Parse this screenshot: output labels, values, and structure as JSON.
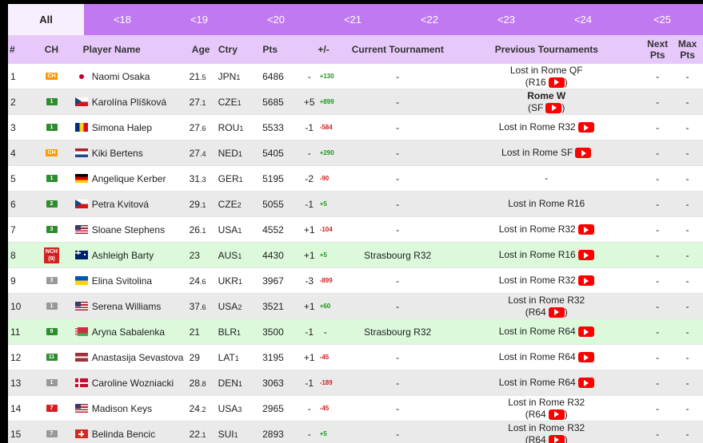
{
  "tabs": [
    "All",
    "<18",
    "<19",
    "<20",
    "<21",
    "<22",
    "<23",
    "<24",
    "<25"
  ],
  "headers": {
    "rank": "#",
    "ch": "CH",
    "name": "Player Name",
    "age": "Age",
    "ctry": "Ctry",
    "pts": "Pts",
    "pm": "+/-",
    "current": "Current Tournament",
    "previous": "Previous Tournaments",
    "next_a": "Next",
    "next_b": "Pts",
    "max_a": "Max",
    "max_b": "Pts"
  },
  "colors": {
    "tab_bg": "#c079f0",
    "header_bg": "#e6c9fa",
    "gain": "#1a9a1a",
    "loss": "#d42020",
    "youtube": "#ff0000"
  },
  "rows": [
    {
      "rank": "1",
      "ch": "CH",
      "ch_color": "#ff9900",
      "flag": "JPN",
      "name": "Naomi Osaka",
      "age": "21",
      "age_dec": ".5",
      "ctry": "JPN",
      "ctry_n": "1",
      "pts": "6486",
      "pm": "-",
      "delta": "+130",
      "delta_dir": "up",
      "current": "-",
      "prev": [
        "Lost in Rome QF",
        "(R16"
      ],
      "yt": 1,
      "next": "-",
      "max": "-",
      "style": ""
    },
    {
      "rank": "2",
      "ch": "1",
      "ch_color": "#2e8b2e",
      "flag": "CZE",
      "name": "Karolína Plíšková",
      "age": "27",
      "age_dec": ".1",
      "ctry": "CZE",
      "ctry_n": "1",
      "pts": "5685",
      "pm": "+5",
      "delta": "+899",
      "delta_dir": "up",
      "current": "-",
      "prev": [
        "Rome W",
        "(SF"
      ],
      "prev_bold": true,
      "yt": 1,
      "next": "-",
      "max": "-",
      "style": "alt"
    },
    {
      "rank": "3",
      "ch": "1",
      "ch_color": "#2e8b2e",
      "flag": "ROU",
      "name": "Simona Halep",
      "age": "27",
      "age_dec": ".6",
      "ctry": "ROU",
      "ctry_n": "1",
      "pts": "5533",
      "pm": "-1",
      "delta": "-584",
      "delta_dir": "down",
      "current": "-",
      "prev": [
        "Lost in Rome R32"
      ],
      "yt": 0,
      "next": "-",
      "max": "-",
      "style": ""
    },
    {
      "rank": "4",
      "ch": "CH",
      "ch_color": "#ff9900",
      "flag": "NED",
      "name": "Kiki Bertens",
      "age": "27",
      "age_dec": ".4",
      "ctry": "NED",
      "ctry_n": "1",
      "pts": "5405",
      "pm": "-",
      "delta": "+290",
      "delta_dir": "up",
      "current": "-",
      "prev": [
        "Lost in Rome SF"
      ],
      "yt": 0,
      "next": "-",
      "max": "-",
      "style": "alt"
    },
    {
      "rank": "5",
      "ch": "1",
      "ch_color": "#2e8b2e",
      "flag": "GER",
      "name": "Angelique Kerber",
      "age": "31",
      "age_dec": ".3",
      "ctry": "GER",
      "ctry_n": "1",
      "pts": "5195",
      "pm": "-2",
      "delta": "-90",
      "delta_dir": "down",
      "current": "-",
      "prev": [
        "-"
      ],
      "yt": -1,
      "next": "-",
      "max": "-",
      "style": ""
    },
    {
      "rank": "6",
      "ch": "2",
      "ch_color": "#2e8b2e",
      "flag": "CZE",
      "name": "Petra Kvitová",
      "age": "29",
      "age_dec": ".1",
      "ctry": "CZE",
      "ctry_n": "2",
      "pts": "5055",
      "pm": "-1",
      "delta": "+5",
      "delta_dir": "up",
      "current": "-",
      "prev": [
        "Lost in Rome R16"
      ],
      "yt": -1,
      "next": "-",
      "max": "-",
      "style": "alt"
    },
    {
      "rank": "7",
      "ch": "3",
      "ch_color": "#2e8b2e",
      "flag": "USA",
      "name": "Sloane Stephens",
      "age": "26",
      "age_dec": ".1",
      "ctry": "USA",
      "ctry_n": "1",
      "pts": "4552",
      "pm": "+1",
      "delta": "-104",
      "delta_dir": "down",
      "current": "-",
      "prev": [
        "Lost in Rome R32"
      ],
      "yt": 0,
      "next": "-",
      "max": "-",
      "style": ""
    },
    {
      "rank": "8",
      "ch": "NCH (9)",
      "ch_color": "#d42020",
      "flag": "AUS",
      "name": "Ashleigh Barty",
      "age": "23",
      "age_dec": "",
      "ctry": "AUS",
      "ctry_n": "1",
      "pts": "4430",
      "pm": "+1",
      "delta": "+5",
      "delta_dir": "up",
      "current": "Strasbourg R32",
      "prev": [
        "Previous Tournaments"
      ],
      "prev_text": "Lost in Rome R16",
      "yt": 0,
      "next": "-",
      "max": "-",
      "style": "green"
    },
    {
      "rank": "9",
      "ch": "3",
      "ch_color": "#999999",
      "flag": "UKR",
      "name": "Elina Svitolina",
      "age": "24",
      "age_dec": ".6",
      "ctry": "UKR",
      "ctry_n": "1",
      "pts": "3967",
      "pm": "-3",
      "delta": "-899",
      "delta_dir": "down",
      "current": "-",
      "prev": [
        "Lost in Rome R32"
      ],
      "yt": 0,
      "next": "-",
      "max": "-",
      "style": ""
    },
    {
      "rank": "10",
      "ch": "1",
      "ch_color": "#999999",
      "flag": "USA",
      "name": "Serena Williams",
      "age": "37",
      "age_dec": ".6",
      "ctry": "USA",
      "ctry_n": "2",
      "pts": "3521",
      "pm": "+1",
      "delta": "+60",
      "delta_dir": "up",
      "current": "-",
      "prev": [
        "Lost in Rome R32",
        "(R64"
      ],
      "yt": 1,
      "next": "-",
      "max": "-",
      "style": "alt"
    },
    {
      "rank": "11",
      "ch": "9",
      "ch_color": "#2e8b2e",
      "flag": "BLR",
      "name": "Aryna Sabalenka",
      "age": "21",
      "age_dec": "",
      "ctry": "BLR",
      "ctry_n": "1",
      "pts": "3500",
      "pm": "-1",
      "delta": "-",
      "delta_dir": "none",
      "current": "Strasbourg R32",
      "prev": [
        "Lost in Rome R64"
      ],
      "yt": 0,
      "next": "-",
      "max": "-",
      "style": "green"
    },
    {
      "rank": "12",
      "ch": "11",
      "ch_color": "#2e8b2e",
      "flag": "LAT",
      "name": "Anastasija Sevastova",
      "age": "29",
      "age_dec": "",
      "ctry": "LAT",
      "ctry_n": "1",
      "pts": "3195",
      "pm": "+1",
      "delta": "-45",
      "delta_dir": "down",
      "current": "-",
      "prev": [
        "Lost in Rome R64"
      ],
      "yt": 0,
      "next": "-",
      "max": "-",
      "style": ""
    },
    {
      "rank": "13",
      "ch": "1",
      "ch_color": "#999999",
      "flag": "DEN",
      "name": "Caroline Wozniacki",
      "age": "28",
      "age_dec": ".8",
      "ctry": "DEN",
      "ctry_n": "1",
      "pts": "3063",
      "pm": "-1",
      "delta": "-189",
      "delta_dir": "down",
      "current": "-",
      "prev": [
        "Lost in Rome R64"
      ],
      "yt": 0,
      "next": "-",
      "max": "-",
      "style": "alt"
    },
    {
      "rank": "14",
      "ch": "7",
      "ch_color": "#d42020",
      "flag": "USA",
      "name": "Madison Keys",
      "age": "24",
      "age_dec": ".2",
      "ctry": "USA",
      "ctry_n": "3",
      "pts": "2965",
      "pm": "-",
      "delta": "-45",
      "delta_dir": "down",
      "current": "-",
      "prev": [
        "Lost in Rome R32",
        "(R64"
      ],
      "yt": 1,
      "next": "-",
      "max": "-",
      "style": ""
    },
    {
      "rank": "15",
      "ch": "7",
      "ch_color": "#999999",
      "flag": "SUI",
      "name": "Belinda Bencic",
      "age": "22",
      "age_dec": ".1",
      "ctry": "SUI",
      "ctry_n": "1",
      "pts": "2893",
      "pm": "-",
      "delta": "+5",
      "delta_dir": "up",
      "current": "-",
      "prev": [
        "Lost in Rome R32",
        "(R64"
      ],
      "yt": 1,
      "next": "-",
      "max": "-",
      "style": "alt"
    }
  ]
}
